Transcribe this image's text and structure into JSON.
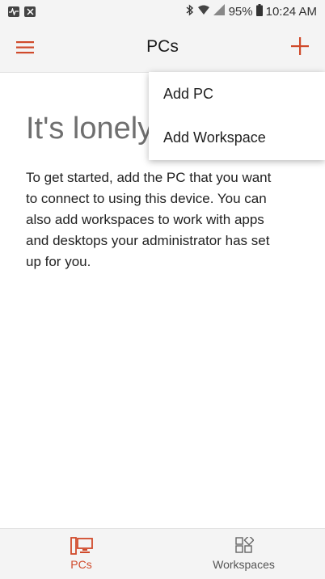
{
  "status_bar": {
    "battery": "95%",
    "time": "10:24 AM"
  },
  "app_bar": {
    "title": "PCs"
  },
  "content": {
    "headline": "It's lonely",
    "body": "To get started, add the PC that you want to connect to using this device. You can also add workspaces to work with apps and desktops your administrator has set up for you."
  },
  "dropdown": {
    "items": [
      {
        "label": "Add PC"
      },
      {
        "label": "Add Workspace"
      }
    ]
  },
  "bottom_nav": {
    "items": [
      {
        "label": "PCs",
        "active": true
      },
      {
        "label": "Workspaces",
        "active": false
      }
    ]
  },
  "colors": {
    "accent": "#d04a2b"
  }
}
